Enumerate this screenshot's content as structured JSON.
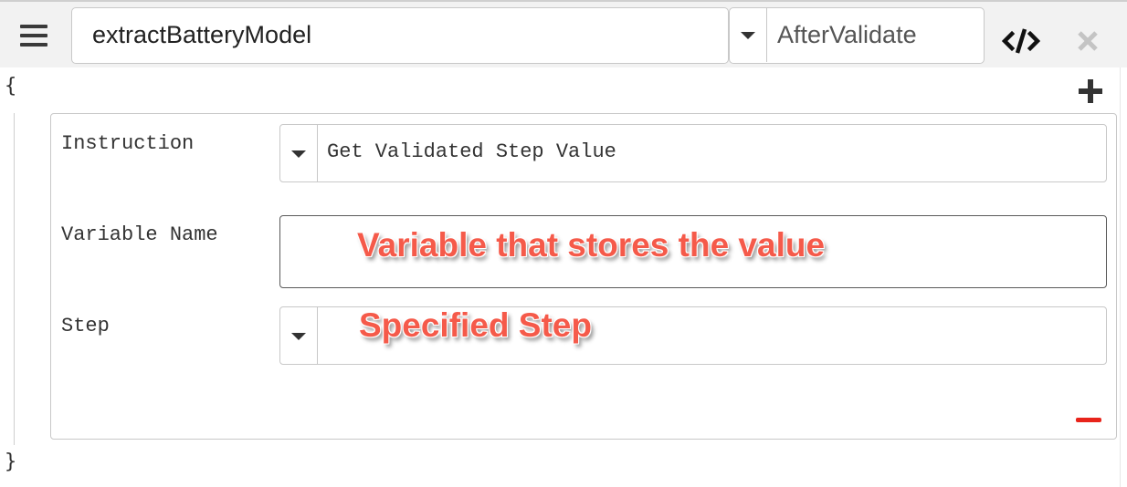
{
  "toolbar": {
    "function_name": "extractBatteryModel",
    "event": "AfterValidate"
  },
  "editor": {
    "open_brace": "{",
    "close_brace": "}"
  },
  "instruction_block": {
    "instruction_label": "Instruction",
    "instruction_value": "Get Validated Step Value",
    "variable_label": "Variable Name",
    "variable_value": "",
    "step_label": "Step",
    "step_value": ""
  },
  "annotations": {
    "variable_note": "Variable that stores the value",
    "step_note": "Specified Step"
  },
  "icons": {
    "menu": "hamburger-icon",
    "code": "code-icon",
    "close": "close-icon",
    "add": "plus-icon",
    "remove": "minus-icon"
  },
  "colors": {
    "annotation": "#f55a4a",
    "remove": "#e8241b"
  }
}
